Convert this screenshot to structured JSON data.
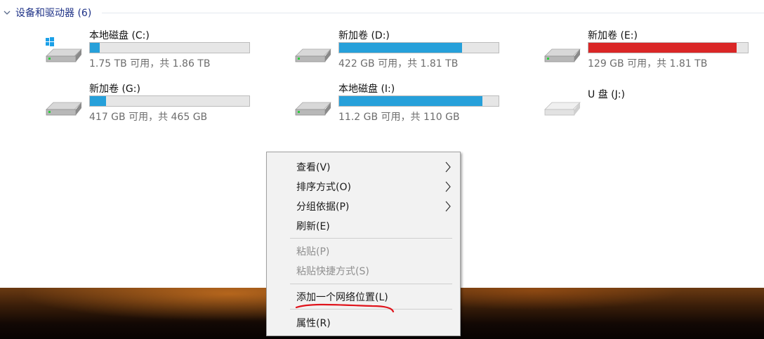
{
  "group": {
    "title": "设备和驱动器 (6)"
  },
  "drives": [
    {
      "name": "本地磁盘 (C:)",
      "info": "1.75 TB 可用，共 1.86 TB",
      "used_fraction": 0.06,
      "bar_color": "#26a0da",
      "icon": "windows-drive-icon"
    },
    {
      "name": "新加卷 (D:)",
      "info": "422 GB 可用，共 1.81 TB",
      "used_fraction": 0.77,
      "bar_color": "#26a0da",
      "icon": "hard-drive-icon"
    },
    {
      "name": "新加卷 (E:)",
      "info": "129 GB 可用，共 1.81 TB",
      "used_fraction": 0.93,
      "bar_color": "#da2626",
      "icon": "hard-drive-icon"
    },
    {
      "name": "新加卷 (G:)",
      "info": "417 GB 可用，共 465 GB",
      "used_fraction": 0.1,
      "bar_color": "#26a0da",
      "icon": "hard-drive-icon"
    },
    {
      "name": "本地磁盘 (I:)",
      "info": "11.2 GB 可用，共 110 GB",
      "used_fraction": 0.9,
      "bar_color": "#26a0da",
      "icon": "hard-drive-icon"
    },
    {
      "name": "U 盘 (J:)",
      "info": "",
      "used_fraction": null,
      "bar_color": "",
      "icon": "usb-drive-icon"
    }
  ],
  "context_menu": {
    "items": [
      {
        "label": "查看(V)",
        "submenu": true,
        "enabled": true
      },
      {
        "label": "排序方式(O)",
        "submenu": true,
        "enabled": true
      },
      {
        "label": "分组依据(P)",
        "submenu": true,
        "enabled": true
      },
      {
        "label": "刷新(E)",
        "submenu": false,
        "enabled": true
      },
      {
        "label": "粘贴(P)",
        "submenu": false,
        "enabled": false
      },
      {
        "label": "粘贴快捷方式(S)",
        "submenu": false,
        "enabled": false
      },
      {
        "label": "添加一个网络位置(L)",
        "submenu": false,
        "enabled": true,
        "annotated": true
      },
      {
        "label": "属性(R)",
        "submenu": false,
        "enabled": true
      }
    ]
  },
  "colors": {
    "header_text": "#1e3287",
    "bar_normal": "#26a0da",
    "bar_warning": "#da2626",
    "annotation": "#e0141c"
  }
}
